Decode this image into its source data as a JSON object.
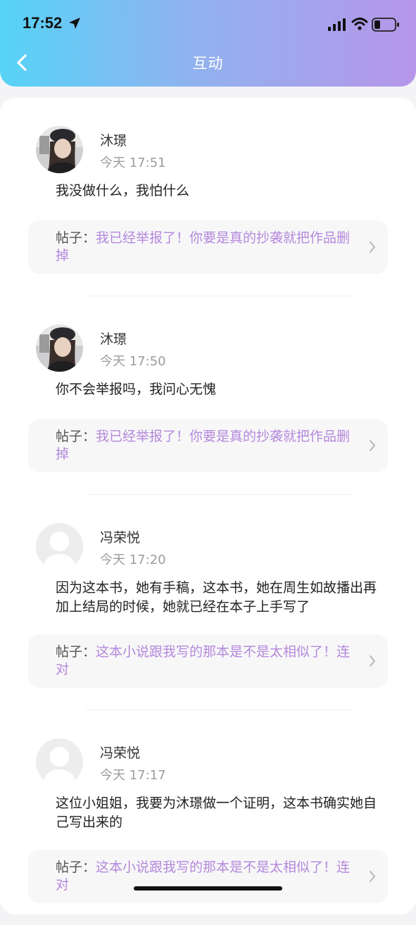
{
  "status_bar": {
    "time": "17:52"
  },
  "header": {
    "title": "互动"
  },
  "post_prefix": "帖子：",
  "items": [
    {
      "user": "沐璟",
      "time": "今天 17:51",
      "avatar": "photo",
      "content": "我没做什么，我怕什么",
      "post": "我已经举报了！你要是真的抄袭就把作品删掉"
    },
    {
      "user": "沐璟",
      "time": "今天 17:50",
      "avatar": "photo",
      "content": "你不会举报吗，我问心无愧",
      "post": "我已经举报了！你要是真的抄袭就把作品删掉"
    },
    {
      "user": "冯荣悦",
      "time": "今天 17:20",
      "avatar": "default",
      "content": "因为这本书，她有手稿，这本书，她在周生如故播出再加上结局的时候，她就已经在本子上手写了",
      "post": "这本小说跟我写的那本是不是太相似了！连对"
    },
    {
      "user": "冯荣悦",
      "time": "今天 17:17",
      "avatar": "default",
      "content": "这位小姐姐，我要为沐璟做一个证明，这本书确实她自己写出来的",
      "post": "这本小说跟我写的那本是不是太相似了！连对"
    }
  ],
  "colors": {
    "accent": "#b488dc",
    "gradient_start": "#56d3f6",
    "gradient_end": "#b796ea"
  }
}
